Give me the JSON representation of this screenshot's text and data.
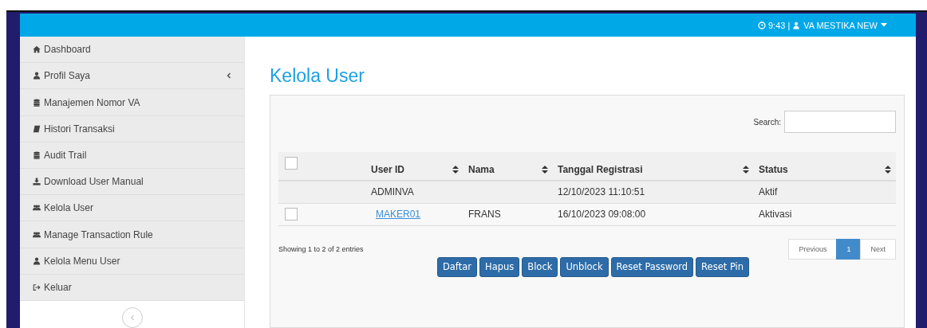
{
  "topbar": {
    "time": "9:43",
    "separator": "|",
    "user": "VA MESTIKA NEW"
  },
  "sidebar": {
    "items": [
      {
        "label": "Dashboard",
        "caret": false
      },
      {
        "label": "Profil Saya",
        "caret": true
      },
      {
        "label": "Manajemen Nomor VA",
        "caret": false
      },
      {
        "label": "Histori Transaksi",
        "caret": false
      },
      {
        "label": "Audit Trail",
        "caret": false
      },
      {
        "label": "Download User Manual",
        "caret": false
      },
      {
        "label": "Kelola User",
        "caret": false
      },
      {
        "label": "Manage Transaction Rule",
        "caret": false
      },
      {
        "label": "Kelola Menu User",
        "caret": false
      },
      {
        "label": "Keluar",
        "caret": false
      }
    ]
  },
  "page_title": "Kelola User",
  "search": {
    "label": "Search:"
  },
  "table": {
    "header_checkbox": {
      "checked": false
    },
    "columns": [
      "User ID",
      "Nama",
      "Tanggal Registrasi",
      "Status"
    ],
    "rows": [
      {
        "kind": "plain",
        "user_id": "ADMINVA",
        "nama": "",
        "tanggal": "12/10/2023 11:10:51",
        "status": "Aktif"
      },
      {
        "kind": "selectable",
        "checked": false,
        "user_id": "MAKER01",
        "nama": "FRANS",
        "tanggal": "16/10/2023 09:08:00",
        "status": "Aktivasi"
      }
    ]
  },
  "info": "Showing 1 to 2 of 2 entries",
  "pagination": {
    "previous": "Previous",
    "pages": [
      {
        "label": "1",
        "selected": true
      }
    ],
    "next": "Next"
  },
  "buttons": [
    "Daftar",
    "Hapus",
    "Block",
    "Unblock",
    "Reset Password",
    "Reset Pin"
  ]
}
